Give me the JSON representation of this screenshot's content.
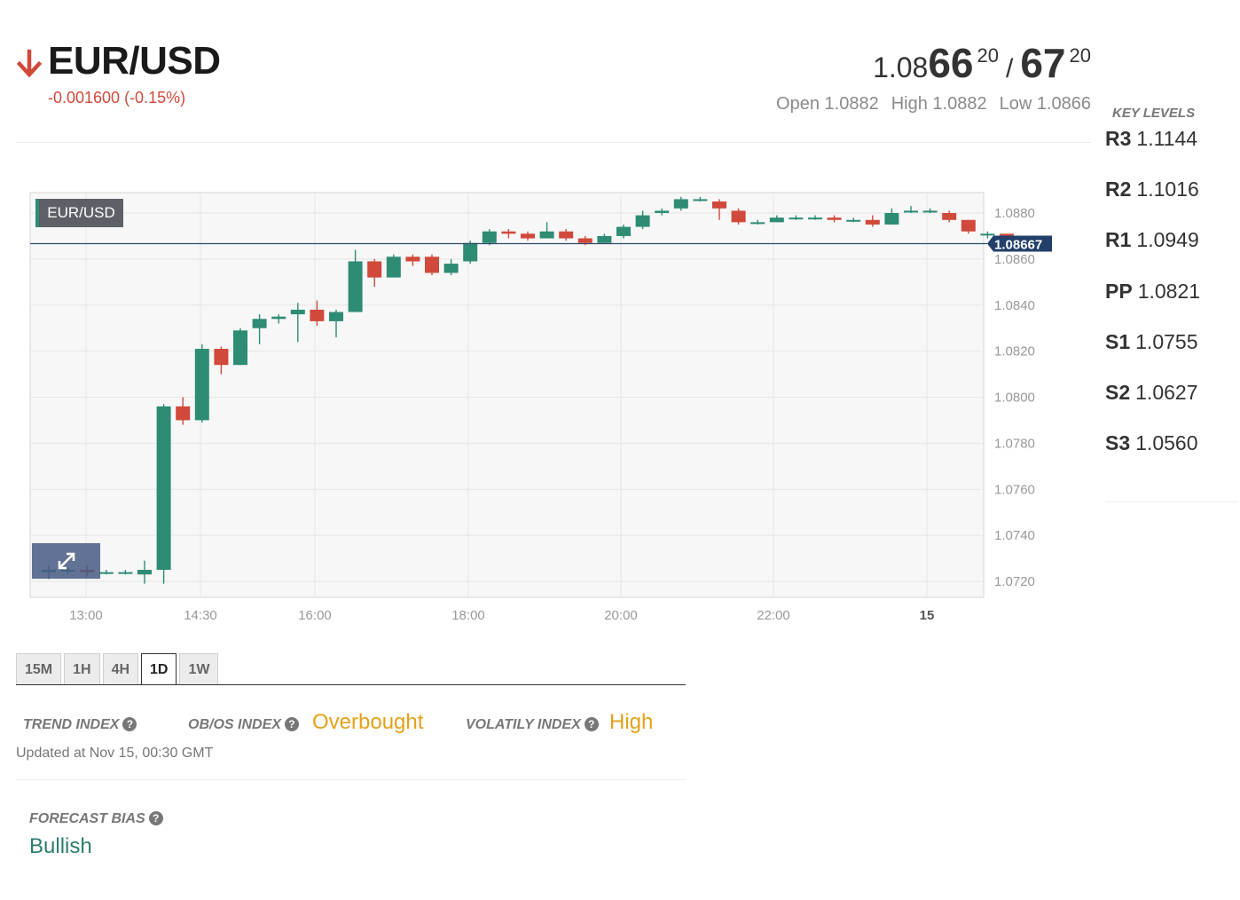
{
  "header": {
    "pair": "EUR/USD",
    "change": "-0.001600 (-0.15%)",
    "direction_icon": "arrow-down-icon",
    "direction_color": "#d0493a"
  },
  "quote": {
    "bid_prefix": "1.08",
    "bid_big": "66",
    "bid_sup": "20",
    "separator": "/",
    "ask_big": "67",
    "ask_sup": "20",
    "open": "Open 1.0882",
    "high": "High 1.0882",
    "low": "Low 1.0866"
  },
  "chart": {
    "label": "EUR/USD",
    "current_price": "1.08667",
    "expand_icon": "expand-icon"
  },
  "chart_data": {
    "type": "candlestick",
    "x_ticks": [
      "13:00",
      "14:30",
      "16:00",
      "18:00",
      "20:00",
      "22:00",
      "15"
    ],
    "y_ticks": [
      "1.0880",
      "1.0860",
      "1.0840",
      "1.0820",
      "1.0800",
      "1.0780",
      "1.0760",
      "1.0740",
      "1.0720"
    ],
    "ylim": [
      1.0713,
      1.0888
    ],
    "current_price": 1.08667,
    "grid": true,
    "up_color": "#2e8b74",
    "down_color": "#d0493a",
    "candles": [
      [
        1.0724,
        1.0725,
        1.0727,
        1.0721
      ],
      [
        1.0725,
        1.0725,
        1.0726,
        1.0723
      ],
      [
        1.0725,
        1.0724,
        1.0727,
        1.0722
      ],
      [
        1.0724,
        1.0724,
        1.0725,
        1.0723
      ],
      [
        1.0724,
        1.0724,
        1.0725,
        1.0723
      ],
      [
        1.0723,
        1.0725,
        1.0729,
        1.0719
      ],
      [
        1.0725,
        1.0796,
        1.0797,
        1.0719
      ],
      [
        1.0796,
        1.079,
        1.08,
        1.0788
      ],
      [
        1.079,
        1.0821,
        1.0823,
        1.0789
      ],
      [
        1.0821,
        1.0814,
        1.0822,
        1.081
      ],
      [
        1.0814,
        1.0829,
        1.083,
        1.0814
      ],
      [
        1.083,
        1.0834,
        1.0836,
        1.0823
      ],
      [
        1.0834,
        1.0835,
        1.0836,
        1.0832
      ],
      [
        1.0836,
        1.0838,
        1.0841,
        1.0824
      ],
      [
        1.0838,
        1.0833,
        1.0842,
        1.0831
      ],
      [
        1.0833,
        1.0837,
        1.0838,
        1.0826
      ],
      [
        1.0837,
        1.0859,
        1.0864,
        1.0837
      ],
      [
        1.0859,
        1.0852,
        1.086,
        1.0848
      ],
      [
        1.0852,
        1.0861,
        1.0862,
        1.0852
      ],
      [
        1.0861,
        1.0859,
        1.0862,
        1.0857
      ],
      [
        1.0861,
        1.0854,
        1.0862,
        1.0853
      ],
      [
        1.0854,
        1.0858,
        1.086,
        1.0853
      ],
      [
        1.0859,
        1.0867,
        1.0868,
        1.0858
      ],
      [
        1.0867,
        1.0872,
        1.0873,
        1.0866
      ],
      [
        1.0872,
        1.0871,
        1.0873,
        1.0869
      ],
      [
        1.0871,
        1.0869,
        1.0872,
        1.0868
      ],
      [
        1.0869,
        1.0872,
        1.0876,
        1.0869
      ],
      [
        1.0872,
        1.0869,
        1.0873,
        1.0868
      ],
      [
        1.0869,
        1.0867,
        1.087,
        1.0866
      ],
      [
        1.0867,
        1.087,
        1.0871,
        1.0867
      ],
      [
        1.087,
        1.0874,
        1.0875,
        1.0869
      ],
      [
        1.0874,
        1.0879,
        1.0881,
        1.0873
      ],
      [
        1.088,
        1.0881,
        1.0882,
        1.0879
      ],
      [
        1.0882,
        1.0886,
        1.0887,
        1.0881
      ],
      [
        1.0886,
        1.0886,
        1.0887,
        1.0885
      ],
      [
        1.0885,
        1.0882,
        1.0886,
        1.0877
      ],
      [
        1.0881,
        1.0876,
        1.0882,
        1.0875
      ],
      [
        1.0876,
        1.0876,
        1.0877,
        1.0875
      ],
      [
        1.0876,
        1.0878,
        1.0879,
        1.0876
      ],
      [
        1.0878,
        1.0878,
        1.0879,
        1.0877
      ],
      [
        1.0878,
        1.0878,
        1.0879,
        1.0877
      ],
      [
        1.0878,
        1.0877,
        1.0879,
        1.0876
      ],
      [
        1.0877,
        1.0877,
        1.0878,
        1.0876
      ],
      [
        1.0877,
        1.0875,
        1.0879,
        1.0874
      ],
      [
        1.0875,
        1.088,
        1.0882,
        1.0875
      ],
      [
        1.0881,
        1.0881,
        1.0883,
        1.088
      ],
      [
        1.0881,
        1.0881,
        1.0882,
        1.088
      ],
      [
        1.088,
        1.0877,
        1.0881,
        1.0876
      ],
      [
        1.0877,
        1.0872,
        1.0877,
        1.0871
      ],
      [
        1.0871,
        1.0871,
        1.0872,
        1.0869
      ],
      [
        1.0871,
        1.0866,
        1.0871,
        1.0865
      ]
    ]
  },
  "timeframes": {
    "tabs": [
      "15M",
      "1H",
      "4H",
      "1D",
      "1W"
    ],
    "active": "1D"
  },
  "indices": {
    "trend_label": "TREND INDEX",
    "obos_label": "OB/OS INDEX",
    "obos_value": "Overbought",
    "volatility_label": "VOLATILY INDEX",
    "volatility_value": "High",
    "updated": "Updated at Nov 15, 00:30 GMT"
  },
  "forecast": {
    "label": "FORECAST BIAS",
    "value": "Bullish"
  },
  "key_levels": {
    "title": "KEY LEVELS",
    "items": [
      {
        "name": "R3",
        "value": "1.1144"
      },
      {
        "name": "R2",
        "value": "1.1016"
      },
      {
        "name": "R1",
        "value": "1.0949"
      },
      {
        "name": "PP",
        "value": "1.0821"
      },
      {
        "name": "S1",
        "value": "1.0755"
      },
      {
        "name": "S2",
        "value": "1.0627"
      },
      {
        "name": "S3",
        "value": "1.0560"
      }
    ]
  }
}
